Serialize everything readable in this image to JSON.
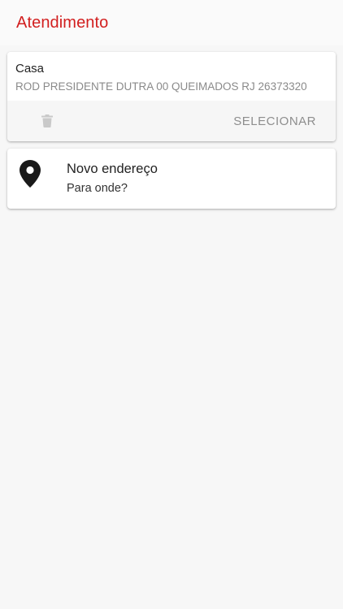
{
  "header": {
    "title": "Atendimento",
    "title_color": "#d21f1f"
  },
  "saved_addresses": [
    {
      "name": "Casa",
      "address": "ROD PRESIDENTE DUTRA 00 QUEIMADOS RJ 26373320",
      "delete_icon": "trash-icon",
      "select_label": "SELECIONAR"
    }
  ],
  "new_address": {
    "icon": "location-pin-icon",
    "title": "Novo endereço",
    "subtitle": "Para onde?"
  }
}
